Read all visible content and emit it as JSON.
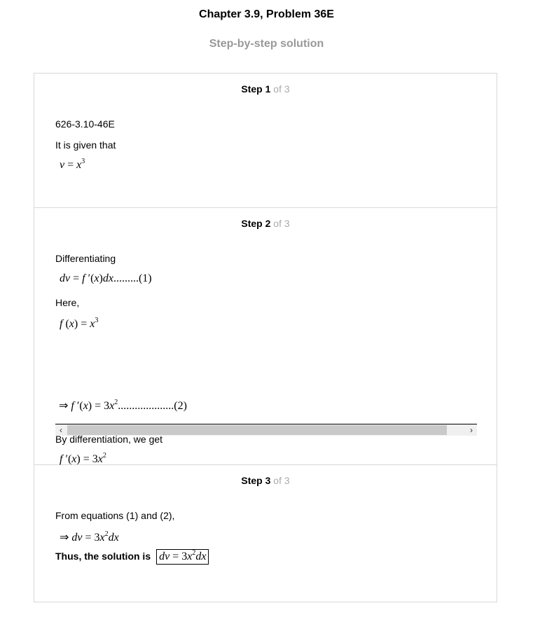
{
  "header": {
    "title": "Chapter 3.9, Problem 36E",
    "subtitle": "Step-by-step solution"
  },
  "step_word": "Step",
  "of_text": "of 3",
  "steps": [
    {
      "number": "1",
      "code": "626-3.10-46E",
      "given_text": "It is given that"
    },
    {
      "number": "2",
      "differentiating_text": "Differentiating",
      "here_text": "Here,",
      "by_diff_text": "By differentiation, we get"
    },
    {
      "number": "3",
      "from_text": "From equations (1) and (2),",
      "thus_text": "Thus, the solution is"
    }
  ],
  "scrollbar": {
    "left_icon": "chevron-left-icon",
    "right_icon": "chevron-right-icon"
  }
}
